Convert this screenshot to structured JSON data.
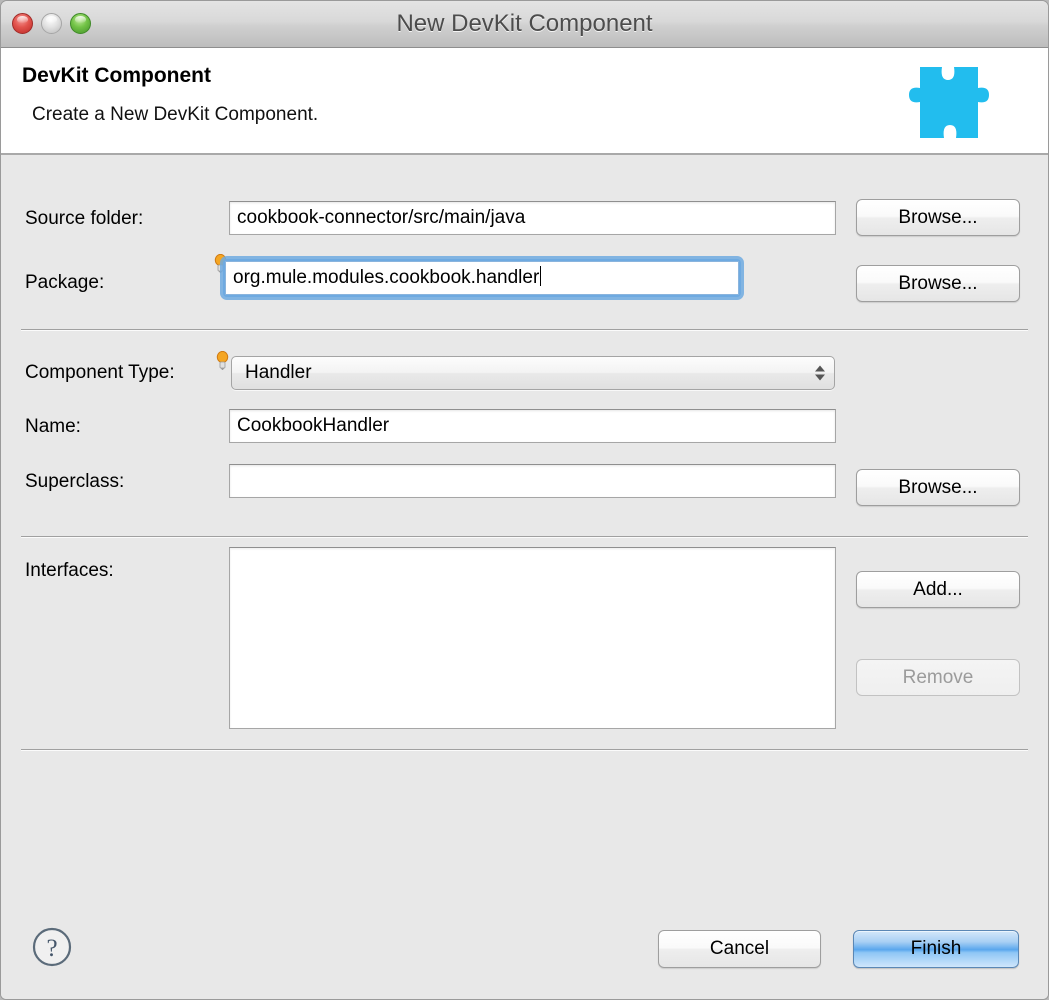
{
  "window": {
    "title": "New DevKit Component",
    "traffic_lights": [
      {
        "name": "close",
        "color": "#e2534d"
      },
      {
        "name": "minimize",
        "color": "#e2e2e2"
      },
      {
        "name": "zoom",
        "color": "#72c346"
      }
    ]
  },
  "header": {
    "title": "DevKit Component",
    "subtitle": "Create a New DevKit Component.",
    "icon": "puzzle-piece-icon",
    "icon_color": "#22bdee"
  },
  "form": {
    "source_folder": {
      "label": "Source folder:",
      "value": "cookbook-connector/src/main/java",
      "placeholder": "",
      "browse_label": "Browse..."
    },
    "package": {
      "label": "Package:",
      "value": "org.mule.modules.cookbook.handler",
      "placeholder": "",
      "browse_label": "Browse...",
      "focused": true,
      "hint_icon": "lightbulb-icon"
    },
    "component_type": {
      "label": "Component Type:",
      "value": "Handler",
      "hint_icon": "lightbulb-icon",
      "options": [
        "Handler"
      ]
    },
    "name": {
      "label": "Name:",
      "value": "CookbookHandler",
      "placeholder": ""
    },
    "superclass": {
      "label": "Superclass:",
      "value": "",
      "placeholder": "",
      "browse_label": "Browse..."
    },
    "interfaces": {
      "label": "Interfaces:",
      "items": [],
      "add_label": "Add...",
      "remove_label": "Remove",
      "remove_enabled": false
    }
  },
  "footer": {
    "help_icon": "help-question-icon",
    "cancel_label": "Cancel",
    "finish_label": "Finish",
    "default_button": "Finish"
  }
}
